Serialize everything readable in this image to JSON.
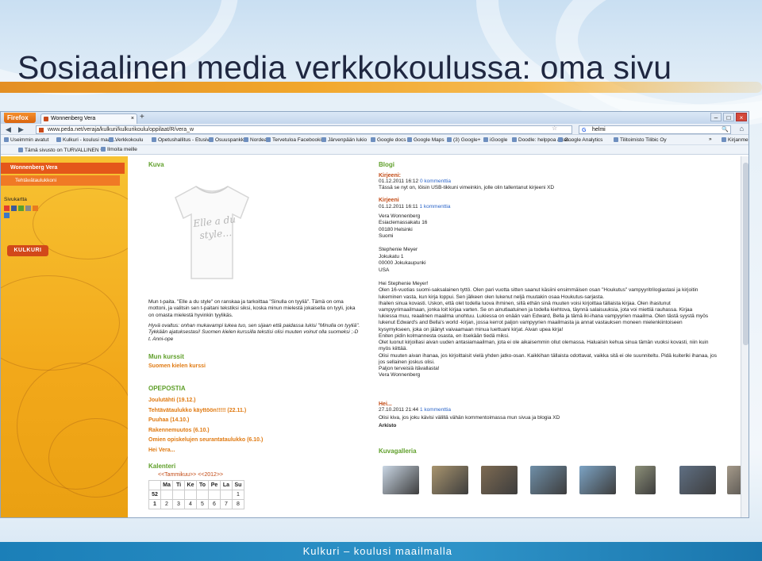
{
  "slide": {
    "title": "Sosiaalinen media verkkokoulussa: oma sivu",
    "footer": "Kulkuri – koulusi maailmalla"
  },
  "browser": {
    "app_button": "Firefox",
    "tab_title": "Wonnenberg Vera",
    "tab_close": "×",
    "new_tab": "+",
    "url": "www.peda.net/veraja/kulkuri/kulkurikoulu/oppilaat/R/vera_w",
    "search_engine_icon": "G",
    "search_value": "helmi",
    "bookmarks": [
      "Useimmin avatut",
      "Kulkuri - koulusi maail...",
      "Verkkokoulu",
      "Opetushallitus - Etusivu",
      "Osuuspankki",
      "Nordea",
      "Tervetuloa Facebooki...",
      "Järvenpään lukio",
      "Google docs",
      "Google Maps",
      "(3) Google+",
      "iGoogle",
      "Doodle: helppoa aikat...",
      "Google Analytics",
      "Tilitoimisto Tilibic Oy",
      "Kirjanmerkit"
    ],
    "bookmarks_more": "»",
    "bookmarks2": [
      "Tämä sivusto on TURVALLINEN ▾",
      "Ilmoita meille"
    ]
  },
  "sidebar": {
    "user": "Wonnenberg Vera",
    "sub": "Tehtävätaulukkoni",
    "sivukartta": "Sivukartta",
    "logo": "KULKURI",
    "icon_colors": [
      "#e23b2e",
      "#3b5998",
      "#5aa02c",
      "#888888",
      "#e87b1e",
      "#3b78c8"
    ]
  },
  "main": {
    "kuva_header": "Kuva",
    "shirt_text": "Elle a du style…",
    "intro": "Mun t-paita. \"Elle a du style\" on ranskaa ja tarkoittaa \"Sinulla on tyyliä\". Tämä on oma mottoni, ja valitsin sen t-paitani tekstiksi siksi, koska minun mielestä jokaisella on tyyli, joka on omasta mielestä hyvinkin tyylikäs.",
    "quote": "Hyvä ovaltus: onhan mukavampi lukea tuo, sen sijaan että paidassa lukisi \"Minulla on tyyliä\". Tykkään ajatuksestasi! Suomen kielen kurssilla tekstisi olisi muuten voinut olla suomeksi ;-D t. Anni-ope",
    "kurssit_header": "Mun kurssit",
    "kurssit": [
      "Suomen kielen kurssi"
    ],
    "opepostia_header": "OPEPOSTIA",
    "opepostia": [
      "Joulutähti (19.12.)",
      "Tehtävätaulukko käyttöön!!!!! (22.11.)",
      "Puuhaa (14.10.)",
      "Rakennemuutos (6.10.)",
      "Omien opiskelujen seurantataulukko (6.10.)",
      "Hei Vera..."
    ],
    "kalenteri_header": "Kalenteri",
    "cal_nav": "<<Tammikuu>> <<2012>>",
    "cal_days": [
      "Ma",
      "Ti",
      "Ke",
      "To",
      "Pe",
      "La",
      "Su"
    ],
    "cal_weeks": [
      {
        "week": "52",
        "days": [
          "",
          "",
          "",
          "",
          "",
          "",
          "1"
        ]
      },
      {
        "week": "1",
        "days": [
          "2",
          "3",
          "4",
          "5",
          "6",
          "7",
          "8"
        ]
      }
    ]
  },
  "blog": {
    "header": "Blogi",
    "post1_title": "Kirjeeni:",
    "post1_meta": "01.12.2011 16:12",
    "post1_comments": "0 kommenttia",
    "post1_text": "Tässä se nyt on, löisin USB-tikkuni vimeinkin, jolle olin tallentanut kirjeeni XD",
    "post2_title": "Kirjeeni",
    "post2_meta": "01.12.2011 16:11",
    "post2_comments": "1 kommenttia",
    "address1": [
      "Vera Wonnenberg",
      "Esiaclemassakatu 16",
      "00180 Helsinki",
      "Suomi"
    ],
    "address2": [
      "Stephenie Meyer",
      "Jokukatu 1",
      "00000 Jokukaupunki",
      "USA"
    ],
    "greeting": "Hei Stephenie Meyer!",
    "letter": [
      "Olen 16-vuotias suomi-saksalainen tyttö. Olen pari vuotta sitten saanut käsiini ensimmäisen osan \"Houkutus\" vampyyritrilogiastasi ja kirjoitin",
      "lukeminen vasta, kun kirja loppui. Sen jälkeen olen lukenut neljä muutakin osaa Houkutus-sarjasta.",
      "Ihailen sinua kovasti. Uskon, että olet todella luova ihminen, sillä ethän sinä muuten voisi kirjoittaa tällaista kirjaa. Olen ihastunut",
      "vampyyrimaailmaan, jonka loit kirjaa varten. Se on ainutlaatuinen ja todella kiehtova, täynnä salaisuuksia, jota voi miettiä rauhassa. Kirjaa",
      "lukiessa muu, reaalinen maailma unohtuu. Lukiessa on enään vain Edward, Bella ja tämä iki-ihana vampyyrien maailma. Olen tästä syystä myös",
      "lukenut Edward's and Bella's world -kirjan, jossa kerrot paljon vampyyrien maailmasta ja annat vastauksen moneen mielenkiintoiseen",
      "kysymykseen, joka on jäänyt vaivaamaan minua luettuani kirjat. Aivan upea kirja!",
      "Eniten pidin kolmannesta osasta, en itsekään tiedä miksi.",
      "Olet luonut kirjoillasi aivan uuden antasiamaailman, jota ei ole aikaisemmin ollut olemassa. Haluaisin kehua sinua tämän vuoksi kovasti, niin kuin",
      "myös kiittää.",
      "Olisi muuten aivan ihanaa, jos kirjoittaisit vielä yhden jatko-osan. Kaikkihan tällaista odottavat, vaikka sitä ei ole suunniteltu. Pidä kuiteriki ihanaa, jos",
      "jos sellainen joskus olisi.",
      "Paljon terveisiä itävallasta!",
      "Vera Wonnenberg"
    ],
    "post3_title": "Hei...",
    "post3_meta": "27.10.2011 21:44",
    "post3_comments": "1 kommenttia",
    "post3_text": "Olisi kiva, jos joku kävisi välillä vähän kommentoimassa mun sivua ja blogia XD",
    "arkisto": "Arkisto",
    "gallery_header": "Kuvagalleria",
    "gallery_colors": [
      "#c9d6e4",
      "#a8946e",
      "#7d6a52",
      "#6f8fa8",
      "#7ca3c4",
      "#8c8f78",
      "#5f6f83",
      "#a59a8a"
    ]
  },
  "icons": [
    "firefox-menu",
    "back-arrow",
    "forward-arrow",
    "home-icon",
    "search-icon",
    "star-icon",
    "close-icon"
  ]
}
